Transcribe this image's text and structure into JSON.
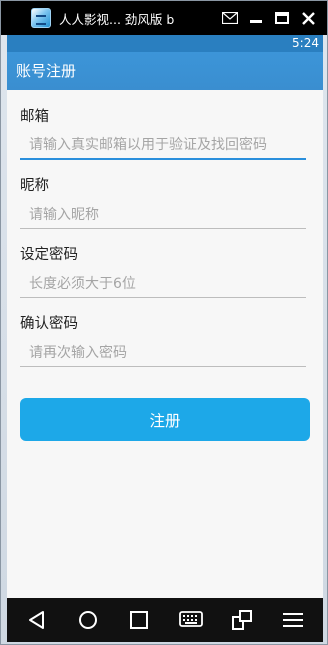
{
  "window": {
    "title": "人人影视... 劲风版 b",
    "controls": [
      "email-icon",
      "minimize-icon",
      "maximize-icon",
      "close-icon"
    ]
  },
  "statusbar": {
    "time": "5:24"
  },
  "actionbar": {
    "title": "账号注册"
  },
  "form": {
    "email": {
      "label": "邮箱",
      "placeholder": "请输入真实邮箱以用于验证及找回密码"
    },
    "nickname": {
      "label": "昵称",
      "placeholder": "请输入昵称"
    },
    "password": {
      "label": "设定密码",
      "placeholder": "长度必须大于6位"
    },
    "confirm": {
      "label": "确认密码",
      "placeholder": "请再次输入密码"
    },
    "submit_label": "注册"
  },
  "navbar": {
    "buttons": [
      "back-icon",
      "home-icon",
      "recents-icon",
      "keyboard-icon",
      "rotate-icon",
      "menu-icon"
    ]
  },
  "colors": {
    "accent": "#1da8e8",
    "actionbar": "#3a8ed0",
    "statusbar": "#2a7fc0"
  }
}
